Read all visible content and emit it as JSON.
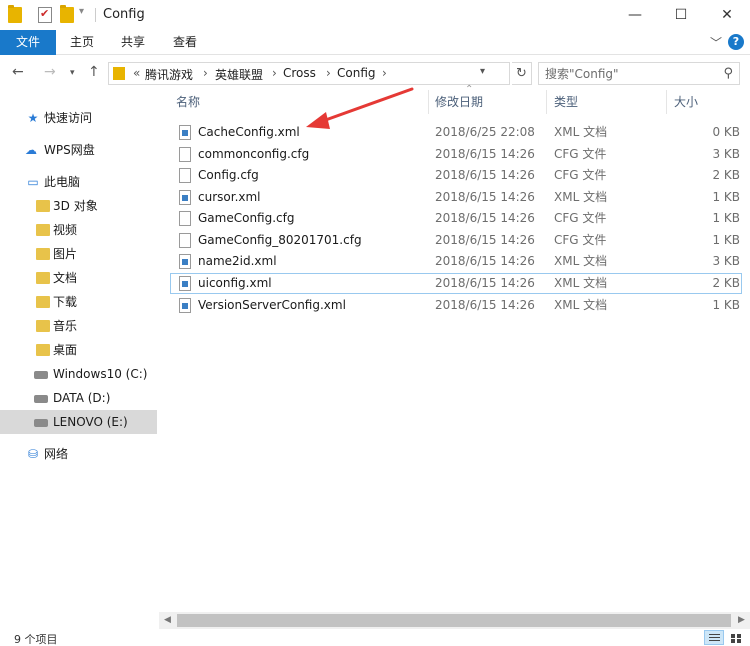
{
  "window": {
    "title": "Config",
    "minimize": "—",
    "maximize": "☐",
    "close": "✕"
  },
  "ribbon": {
    "tabs": [
      "文件",
      "主页",
      "共享",
      "查看"
    ],
    "expand_icon": "chevron-down-icon",
    "help_label": "?"
  },
  "address": {
    "overflow": "«",
    "crumbs": [
      "腾讯游戏",
      "英雄联盟",
      "Cross",
      "Config"
    ],
    "separator": "›"
  },
  "search": {
    "placeholder": "搜索\"Config\""
  },
  "sidebar": {
    "items": [
      {
        "label": "快速访问",
        "icon": "star-icon"
      },
      {
        "label": "WPS网盘",
        "icon": "cloud-icon"
      },
      {
        "label": "此电脑",
        "icon": "computer-icon"
      },
      {
        "label": "3D 对象",
        "icon": "folder-icon"
      },
      {
        "label": "视频",
        "icon": "folder-icon"
      },
      {
        "label": "图片",
        "icon": "folder-icon"
      },
      {
        "label": "文档",
        "icon": "folder-icon"
      },
      {
        "label": "下载",
        "icon": "folder-icon"
      },
      {
        "label": "音乐",
        "icon": "folder-icon"
      },
      {
        "label": "桌面",
        "icon": "folder-icon"
      },
      {
        "label": "Windows10 (C:)",
        "icon": "drive-icon"
      },
      {
        "label": "DATA (D:)",
        "icon": "drive-icon"
      },
      {
        "label": "LENOVO (E:)",
        "icon": "drive-icon"
      },
      {
        "label": "网络",
        "icon": "network-icon"
      }
    ],
    "selected": "LENOVO (E:)"
  },
  "columns": {
    "name": "名称",
    "modified": "修改日期",
    "type": "类型",
    "size": "大小"
  },
  "files": [
    {
      "name": "CacheConfig.xml",
      "modified": "2018/6/25 22:08",
      "type": "XML 文档",
      "size": "0 KB"
    },
    {
      "name": "commonconfig.cfg",
      "modified": "2018/6/15 14:26",
      "type": "CFG 文件",
      "size": "3 KB"
    },
    {
      "name": "Config.cfg",
      "modified": "2018/6/15 14:26",
      "type": "CFG 文件",
      "size": "2 KB"
    },
    {
      "name": "cursor.xml",
      "modified": "2018/6/15 14:26",
      "type": "XML 文档",
      "size": "1 KB"
    },
    {
      "name": "GameConfig.cfg",
      "modified": "2018/6/15 14:26",
      "type": "CFG 文件",
      "size": "1 KB"
    },
    {
      "name": "GameConfig_80201701.cfg",
      "modified": "2018/6/15 14:26",
      "type": "CFG 文件",
      "size": "1 KB"
    },
    {
      "name": "name2id.xml",
      "modified": "2018/6/15 14:26",
      "type": "XML 文档",
      "size": "3 KB"
    },
    {
      "name": "uiconfig.xml",
      "modified": "2018/6/15 14:26",
      "type": "XML 文档",
      "size": "2 KB"
    },
    {
      "name": "VersionServerConfig.xml",
      "modified": "2018/6/15 14:26",
      "type": "XML 文档",
      "size": "1 KB"
    }
  ],
  "selected_file": "uiconfig.xml",
  "status": {
    "item_count": "9 个项目"
  },
  "colors": {
    "accent": "#1979ca",
    "annotation_arrow": "#e53935",
    "selection_border": "#99c9ef"
  }
}
